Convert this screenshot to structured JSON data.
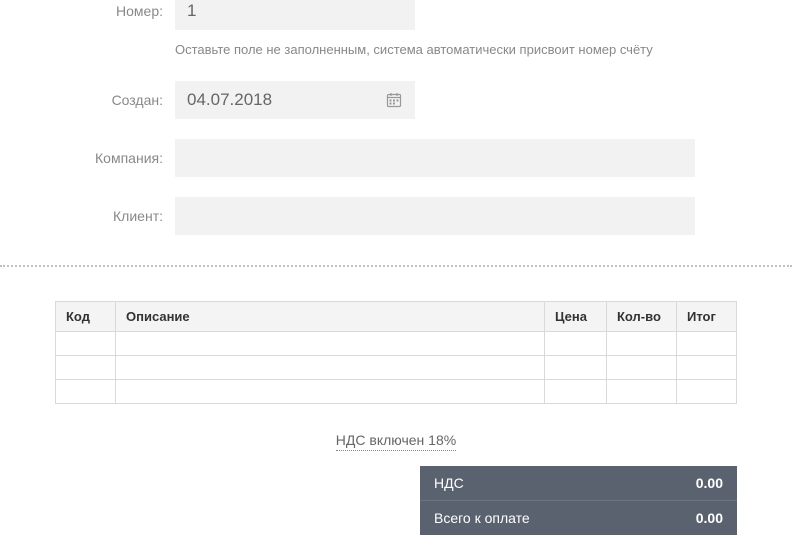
{
  "form": {
    "number": {
      "label": "Номер:",
      "value": "1",
      "hint": "Оставьте поле не заполненным, система автоматически присвоит номер счёту"
    },
    "created": {
      "label": "Создан:",
      "value": "04.07.2018"
    },
    "company": {
      "label": "Компания:",
      "value": ""
    },
    "client": {
      "label": "Клиент:",
      "value": ""
    }
  },
  "table": {
    "headers": {
      "code": "Код",
      "description": "Описание",
      "price": "Цена",
      "qty": "Кол-во",
      "total": "Итог"
    }
  },
  "vat": {
    "text": "НДС включен 18%"
  },
  "totals": {
    "vat_label": "НДС",
    "vat_value": "0.00",
    "grand_label": "Всего к оплате",
    "grand_value": "0.00"
  }
}
